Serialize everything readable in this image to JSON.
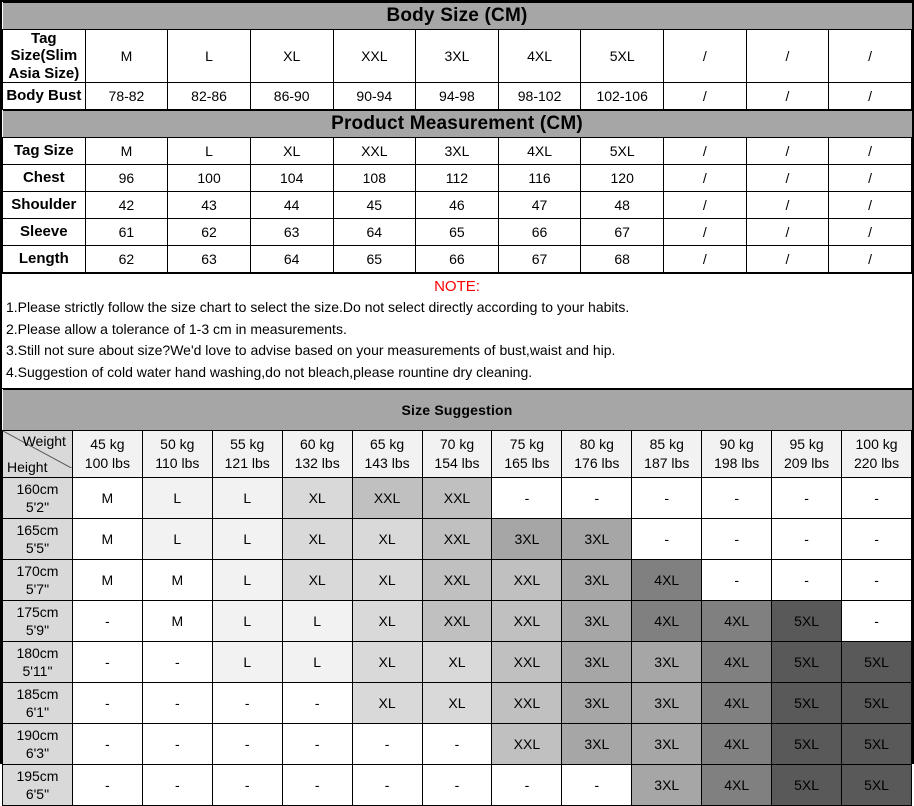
{
  "body_size": {
    "title": "Body Size (CM)",
    "rows": [
      {
        "label": "Tag Size(Slim Asia Size)",
        "values": [
          "M",
          "L",
          "XL",
          "XXL",
          "3XL",
          "4XL",
          "5XL",
          "/",
          "/",
          "/"
        ]
      },
      {
        "label": "Body Bust",
        "values": [
          "78-82",
          "82-86",
          "86-90",
          "90-94",
          "94-98",
          "98-102",
          "102-106",
          "/",
          "/",
          "/"
        ]
      }
    ]
  },
  "product_measurement": {
    "title": "Product Measurement (CM)",
    "rows": [
      {
        "label": "Tag Size",
        "values": [
          "M",
          "L",
          "XL",
          "XXL",
          "3XL",
          "4XL",
          "5XL",
          "/",
          "/",
          "/"
        ]
      },
      {
        "label": "Chest",
        "values": [
          "96",
          "100",
          "104",
          "108",
          "112",
          "116",
          "120",
          "/",
          "/",
          "/"
        ]
      },
      {
        "label": "Shoulder",
        "values": [
          "42",
          "43",
          "44",
          "45",
          "46",
          "47",
          "48",
          "/",
          "/",
          "/"
        ]
      },
      {
        "label": "Sleeve",
        "values": [
          "61",
          "62",
          "63",
          "64",
          "65",
          "66",
          "67",
          "/",
          "/",
          "/"
        ]
      },
      {
        "label": "Length",
        "values": [
          "62",
          "63",
          "64",
          "65",
          "66",
          "67",
          "68",
          "/",
          "/",
          "/"
        ]
      }
    ]
  },
  "note": {
    "heading": "NOTE:",
    "color": "#ff0000",
    "lines": [
      "1.Please strictly follow the size chart to select the size.Do not select directly according to your habits.",
      "2.Please allow a tolerance of 1-3 cm in measurements.",
      "3.Still not sure about size?We'd love to advise based on your measurements of bust,waist and hip.",
      "4.Suggestion of cold water hand washing,do not bleach,please rountine dry cleaning."
    ]
  },
  "size_suggestion": {
    "title": "Size Suggestion",
    "corner": {
      "weight_label": "Weight",
      "height_label": "Height"
    },
    "weight_columns": [
      {
        "kg": "45 kg",
        "lbs": "100 lbs"
      },
      {
        "kg": "50 kg",
        "lbs": "110 lbs"
      },
      {
        "kg": "55 kg",
        "lbs": "121 lbs"
      },
      {
        "kg": "60 kg",
        "lbs": "132 lbs"
      },
      {
        "kg": "65 kg",
        "lbs": "143 lbs"
      },
      {
        "kg": "70 kg",
        "lbs": "154 lbs"
      },
      {
        "kg": "75 kg",
        "lbs": "165 lbs"
      },
      {
        "kg": "80 kg",
        "lbs": "176 lbs"
      },
      {
        "kg": "85 kg",
        "lbs": "187 lbs"
      },
      {
        "kg": "90 kg",
        "lbs": "198 lbs"
      },
      {
        "kg": "95 kg",
        "lbs": "209 lbs"
      },
      {
        "kg": "100 kg",
        "lbs": "220 lbs"
      }
    ],
    "rows": [
      {
        "cm": "160cm",
        "ft": "5'2\"",
        "sizes": [
          "M",
          "L",
          "L",
          "XL",
          "XXL",
          "XXL",
          "-",
          "-",
          "-",
          "-",
          "-",
          "-"
        ]
      },
      {
        "cm": "165cm",
        "ft": "5'5\"",
        "sizes": [
          "M",
          "L",
          "L",
          "XL",
          "XL",
          "XXL",
          "3XL",
          "3XL",
          "-",
          "-",
          "-",
          "-"
        ]
      },
      {
        "cm": "170cm",
        "ft": "5'7\"",
        "sizes": [
          "M",
          "M",
          "L",
          "XL",
          "XL",
          "XXL",
          "XXL",
          "3XL",
          "4XL",
          "-",
          "-",
          "-"
        ]
      },
      {
        "cm": "175cm",
        "ft": "5'9\"",
        "sizes": [
          "-",
          "M",
          "L",
          "L",
          "XL",
          "XXL",
          "XXL",
          "3XL",
          "4XL",
          "4XL",
          "5XL",
          "-"
        ]
      },
      {
        "cm": "180cm",
        "ft": "5'11\"",
        "sizes": [
          "-",
          "-",
          "L",
          "L",
          "XL",
          "XL",
          "XXL",
          "3XL",
          "3XL",
          "4XL",
          "5XL",
          "5XL"
        ]
      },
      {
        "cm": "185cm",
        "ft": "6'1\"",
        "sizes": [
          "-",
          "-",
          "-",
          "-",
          "XL",
          "XL",
          "XXL",
          "3XL",
          "3XL",
          "4XL",
          "5XL",
          "5XL"
        ]
      },
      {
        "cm": "190cm",
        "ft": "6'3\"",
        "sizes": [
          "-",
          "-",
          "-",
          "-",
          "-",
          "-",
          "XXL",
          "3XL",
          "3XL",
          "4XL",
          "5XL",
          "5XL"
        ]
      },
      {
        "cm": "195cm",
        "ft": "6'5\"",
        "sizes": [
          "-",
          "-",
          "-",
          "-",
          "-",
          "-",
          "-",
          "-",
          "3XL",
          "4XL",
          "5XL",
          "5XL"
        ]
      }
    ]
  },
  "palette": {
    "header_gray": "#a6a6a6",
    "M": "#ffffff",
    "L": "#f2f2f2",
    "XL": "#d9d9d9",
    "XXL": "#c0c0c0",
    "3XL": "#a6a6a6",
    "4XL": "#808080",
    "5XL": "#595959"
  }
}
